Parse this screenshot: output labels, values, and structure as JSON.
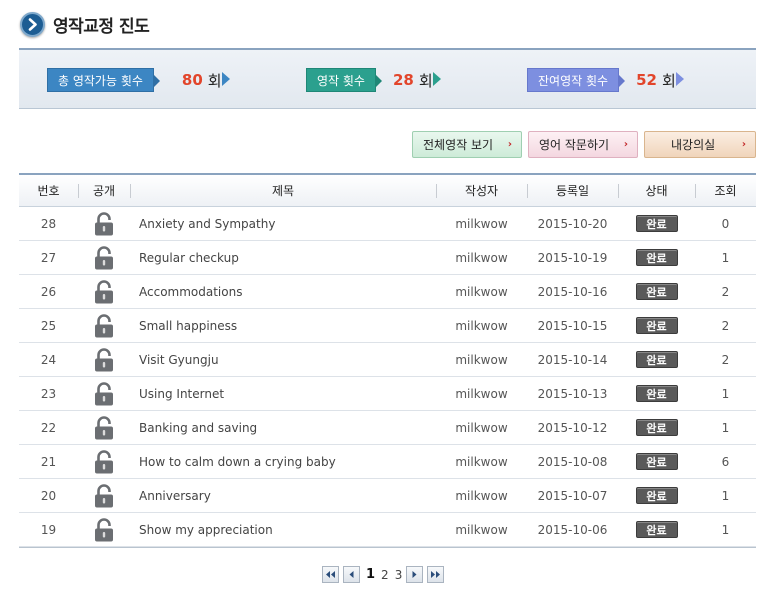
{
  "title": "영작교정 진도",
  "stats": [
    {
      "label": "총 영작가능 횟수",
      "value": "80",
      "unit": "회"
    },
    {
      "label": "영작 횟수",
      "value": "28",
      "unit": "회"
    },
    {
      "label": "잔여영작 횟수",
      "value": "52",
      "unit": "회"
    }
  ],
  "buttons": {
    "all": "전체영작 보기",
    "ask": "영어 작문하기",
    "room": "내강의실"
  },
  "table": {
    "headers": {
      "no": "번호",
      "pub": "공개",
      "title": "제목",
      "author": "작성자",
      "date": "등록일",
      "state": "상태",
      "views": "조회"
    },
    "rows": [
      {
        "no": "28",
        "title": "Anxiety and Sympathy",
        "author": "milkwow",
        "date": "2015-10-20",
        "state": "완료",
        "views": "0"
      },
      {
        "no": "27",
        "title": "Regular checkup",
        "author": "milkwow",
        "date": "2015-10-19",
        "state": "완료",
        "views": "1"
      },
      {
        "no": "26",
        "title": "Accommodations",
        "author": "milkwow",
        "date": "2015-10-16",
        "state": "완료",
        "views": "2"
      },
      {
        "no": "25",
        "title": "Small happiness",
        "author": "milkwow",
        "date": "2015-10-15",
        "state": "완료",
        "views": "2"
      },
      {
        "no": "24",
        "title": "Visit Gyungju",
        "author": "milkwow",
        "date": "2015-10-14",
        "state": "완료",
        "views": "2"
      },
      {
        "no": "23",
        "title": "Using Internet",
        "author": "milkwow",
        "date": "2015-10-13",
        "state": "완료",
        "views": "1"
      },
      {
        "no": "22",
        "title": "Banking and saving",
        "author": "milkwow",
        "date": "2015-10-12",
        "state": "완료",
        "views": "1"
      },
      {
        "no": "21",
        "title": "How to calm down a crying baby",
        "author": "milkwow",
        "date": "2015-10-08",
        "state": "완료",
        "views": "6"
      },
      {
        "no": "20",
        "title": "Anniversary",
        "author": "milkwow",
        "date": "2015-10-07",
        "state": "완료",
        "views": "1"
      },
      {
        "no": "19",
        "title": "Show my appreciation",
        "author": "milkwow",
        "date": "2015-10-06",
        "state": "완료",
        "views": "1"
      }
    ]
  },
  "pagination": {
    "pages": [
      "1",
      "2",
      "3"
    ],
    "current": "1"
  },
  "icons": {
    "title": "chevron-right-icon",
    "lock": "lock-icon",
    "first": "double-left-icon",
    "prev": "left-icon",
    "next": "right-icon",
    "last": "double-right-icon"
  },
  "colors": {
    "accent_value": "#e2452b",
    "stat1": "#3c86c3",
    "stat2": "#2ba08e",
    "stat3": "#7d8fe0"
  }
}
